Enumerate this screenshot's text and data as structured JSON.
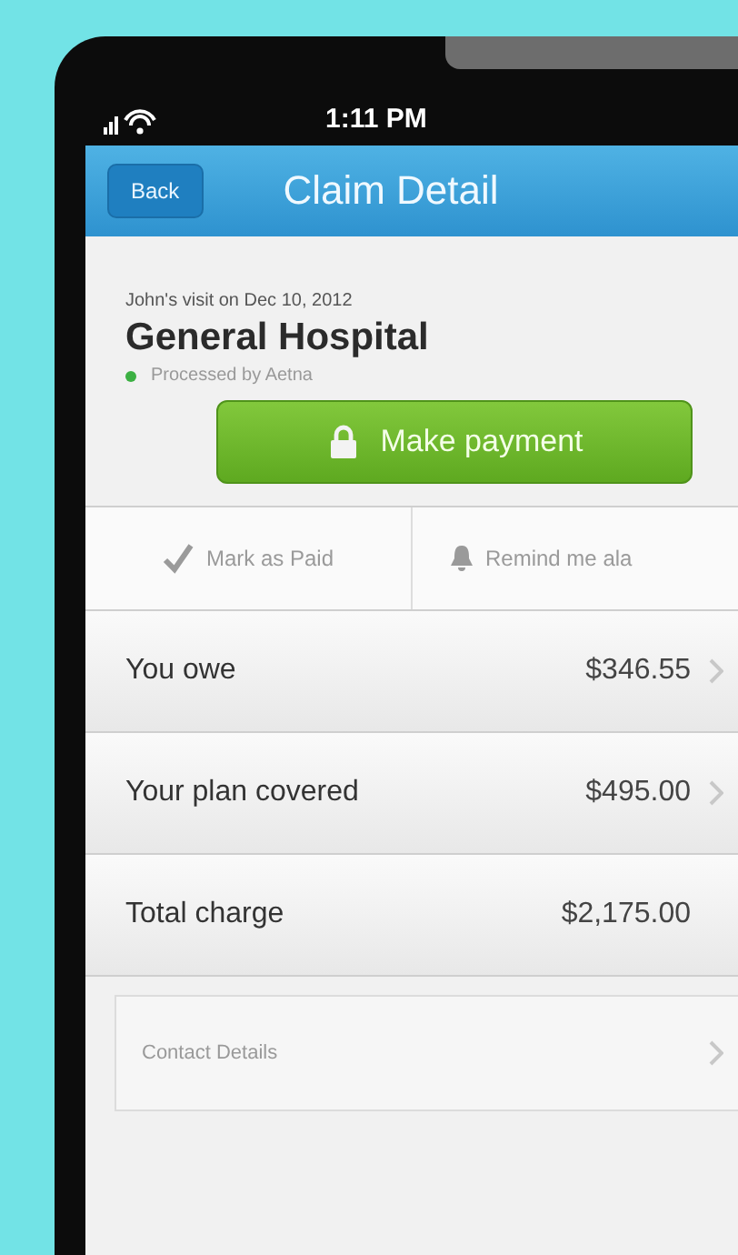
{
  "status_bar": {
    "time": "1:11 PM"
  },
  "nav": {
    "back": "Back",
    "title": "Claim Detail"
  },
  "claim": {
    "visit": "John's visit on Dec 10, 2012",
    "provider": "General Hospital",
    "status": "Processed by Aetna"
  },
  "primary_button": "Make payment",
  "actions": [
    {
      "kind": "check",
      "label": "Mark as Paid"
    },
    {
      "kind": "bell",
      "label": "Remind me ala"
    }
  ],
  "rows": [
    {
      "kind": "amount",
      "label": "You owe",
      "value": "$346.55",
      "chevron": true
    },
    {
      "kind": "amount",
      "label": "Your plan covered",
      "value": "$495.00",
      "chevron": true
    },
    {
      "kind": "amount",
      "label": "Total charge",
      "value": "$2,175.00",
      "chevron": false
    },
    {
      "kind": "link",
      "label": "Contact Details",
      "chevron": true
    }
  ]
}
